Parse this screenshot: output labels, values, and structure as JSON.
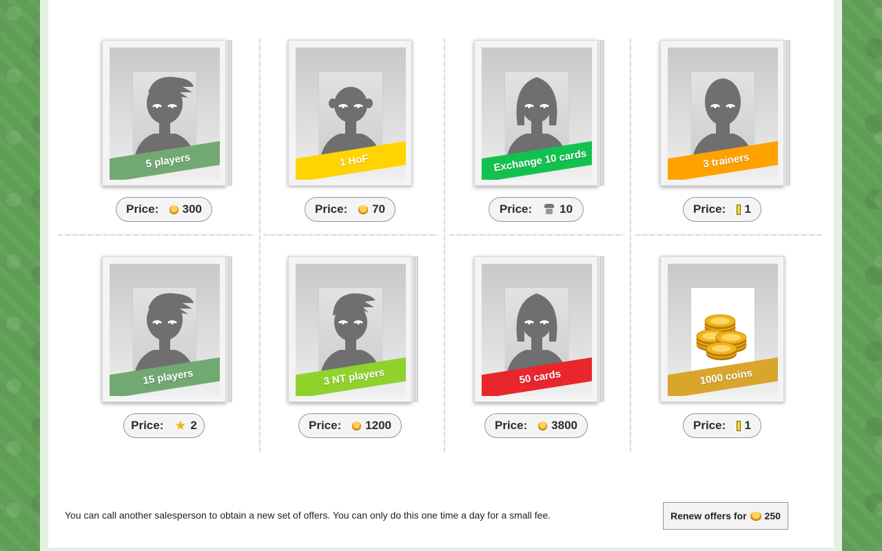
{
  "offers": [
    {
      "label": "5 players",
      "ribbon_color": "#72a972",
      "price_label": "Price:",
      "price_value": "300",
      "currency": "coin-icon",
      "stacked": true,
      "art": "player-spiky"
    },
    {
      "label": "1 HoF",
      "ribbon_color": "#ffd400",
      "price_label": "Price:",
      "price_value": "70",
      "currency": "coin-icon",
      "stacked": false,
      "art": "player-bald-ears"
    },
    {
      "label": "Exchange 10 cards",
      "ribbon_color": "#12c24e",
      "price_label": "Price:",
      "price_value": "10",
      "currency": "spy-icon",
      "stacked": true,
      "art": "player-long-hair"
    },
    {
      "label": "3 trainers",
      "ribbon_color": "#ffa200",
      "price_label": "Price:",
      "price_value": "1",
      "currency": "bar-icon",
      "stacked": true,
      "art": "player-bald"
    },
    {
      "label": "15 players",
      "ribbon_color": "#72a972",
      "price_label": "Price:",
      "price_value": "2",
      "currency": "nt-star-icon",
      "stacked": true,
      "art": "player-spiky"
    },
    {
      "label": "3 NT players",
      "ribbon_color": "#8fd22c",
      "price_label": "Price:",
      "price_value": "1200",
      "currency": "coin-icon",
      "stacked": true,
      "art": "player-mohawk"
    },
    {
      "label": "50 cards",
      "ribbon_color": "#e8262b",
      "price_label": "Price:",
      "price_value": "3800",
      "currency": "coin-icon",
      "stacked": true,
      "art": "player-long-hair"
    },
    {
      "label": "1000 coins",
      "ribbon_color": "#d9a62b",
      "price_label": "Price:",
      "price_value": "1",
      "currency": "bar-icon",
      "stacked": false,
      "art": "coin-pile"
    }
  ],
  "footer": {
    "info_text": "You can call another salesperson to obtain a new set of offers. You can only do this one time a day for a small fee.",
    "renew_label": "Renew offers for",
    "renew_price": "250"
  }
}
